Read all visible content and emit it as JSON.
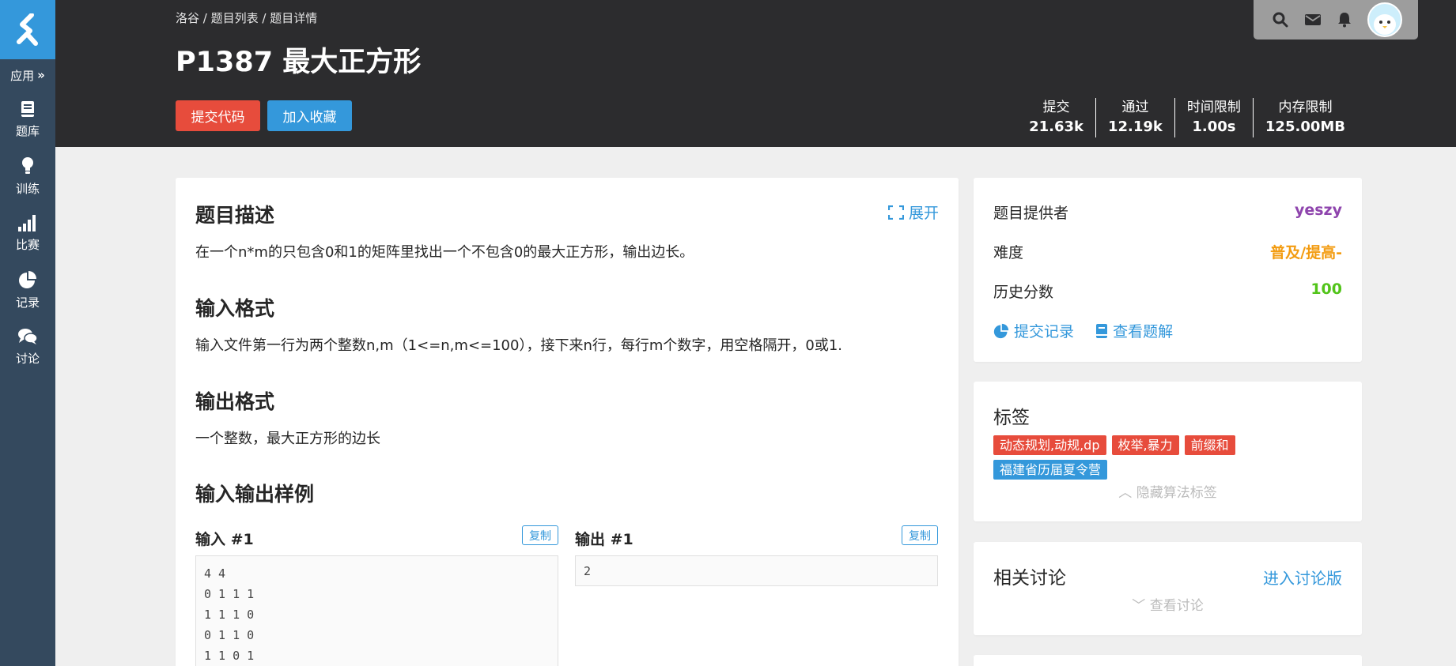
{
  "sidebar": {
    "apps_label": "应用",
    "items": [
      {
        "label": "题库",
        "icon": "book-icon"
      },
      {
        "label": "训练",
        "icon": "bulb-icon"
      },
      {
        "label": "比赛",
        "icon": "signal-bars-icon"
      },
      {
        "label": "记录",
        "icon": "pie-chart-icon"
      },
      {
        "label": "讨论",
        "icon": "chat-icon"
      }
    ]
  },
  "header": {
    "breadcrumb": [
      "洛谷",
      "题目列表",
      "题目详情"
    ],
    "breadcrumb_sep": " / ",
    "title": "P1387 最大正方形",
    "submit_label": "提交代码",
    "favorite_label": "加入收藏",
    "stats": [
      {
        "label": "提交",
        "value": "21.63k"
      },
      {
        "label": "通过",
        "value": "12.19k"
      },
      {
        "label": "时间限制",
        "value": "1.00s"
      },
      {
        "label": "内存限制",
        "value": "125.00MB"
      }
    ]
  },
  "problem": {
    "expand_label": "展开",
    "description_title": "题目描述",
    "description_text": "在一个n*m的只包含0和1的矩阵里找出一个不包含0的最大正方形，输出边长。",
    "input_title": "输入格式",
    "input_text": "输入文件第一行为两个整数n,m（1<=n,m<=100），接下来n行，每行m个数字，用空格隔开，0或1.",
    "output_title": "输出格式",
    "output_text": "一个整数，最大正方形的边长",
    "samples_title": "输入输出样例",
    "sample_input_label": "输入 #1",
    "sample_output_label": "输出 #1",
    "copy_label": "复制",
    "sample_input_lines": [
      "4 4",
      "0 1 1 1",
      "1 1 1 0",
      "0 1 1 0",
      "1 1 0 1"
    ],
    "sample_output": "2"
  },
  "info": {
    "provider_label": "题目提供者",
    "provider_value": "yeszy",
    "difficulty_label": "难度",
    "difficulty_value": "普及/提高-",
    "score_label": "历史分数",
    "score_value": "100",
    "records_link": "提交记录",
    "solutions_link": "查看题解"
  },
  "tags": {
    "title": "标签",
    "items": [
      {
        "label": "动态规划,动规,dp",
        "color": "#e74c3c"
      },
      {
        "label": "枚举,暴力",
        "color": "#e74c3c"
      },
      {
        "label": "前缀和",
        "color": "#e74c3c"
      },
      {
        "label": "福建省历届夏令营",
        "color": "#3498db"
      }
    ],
    "hide_label": "隐藏算法标签"
  },
  "discussion": {
    "title": "相关讨论",
    "enter_label": "进入讨论版",
    "view_label": "查看讨论"
  },
  "colors": {
    "provider": "#8e44ad",
    "difficulty": "#f39c11",
    "score": "#52c41a",
    "accent": "#3498db",
    "danger": "#e74c3c"
  }
}
